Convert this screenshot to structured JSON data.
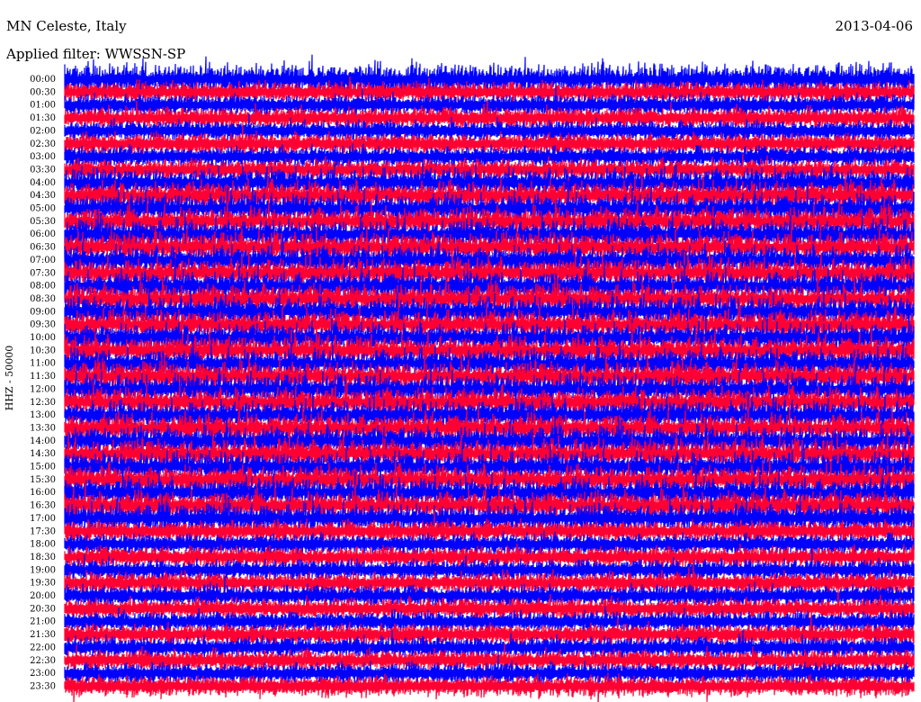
{
  "header": {
    "station": "MN Celeste, Italy",
    "date": "2013-04-06",
    "filter": "Applied filter: WWSSN-SP"
  },
  "chart_data": {
    "type": "line",
    "ylabel": "HHZ - 50000",
    "rows": [
      "00:00",
      "00:30",
      "01:00",
      "01:30",
      "02:00",
      "02:30",
      "03:00",
      "03:30",
      "04:00",
      "04:30",
      "05:00",
      "05:30",
      "06:00",
      "06:30",
      "07:00",
      "07:30",
      "08:00",
      "08:30",
      "09:00",
      "09:30",
      "10:00",
      "10:30",
      "11:00",
      "11:30",
      "12:00",
      "12:30",
      "13:00",
      "13:30",
      "14:00",
      "14:30",
      "15:00",
      "15:30",
      "16:00",
      "16:30",
      "17:00",
      "17:30",
      "18:00",
      "18:30",
      "19:00",
      "19:30",
      "20:00",
      "20:30",
      "21:00",
      "21:30",
      "22:00",
      "22:30",
      "23:00",
      "23:30"
    ],
    "trace_colors": [
      "#0000ff",
      "#ff0033"
    ],
    "grid": false
  }
}
